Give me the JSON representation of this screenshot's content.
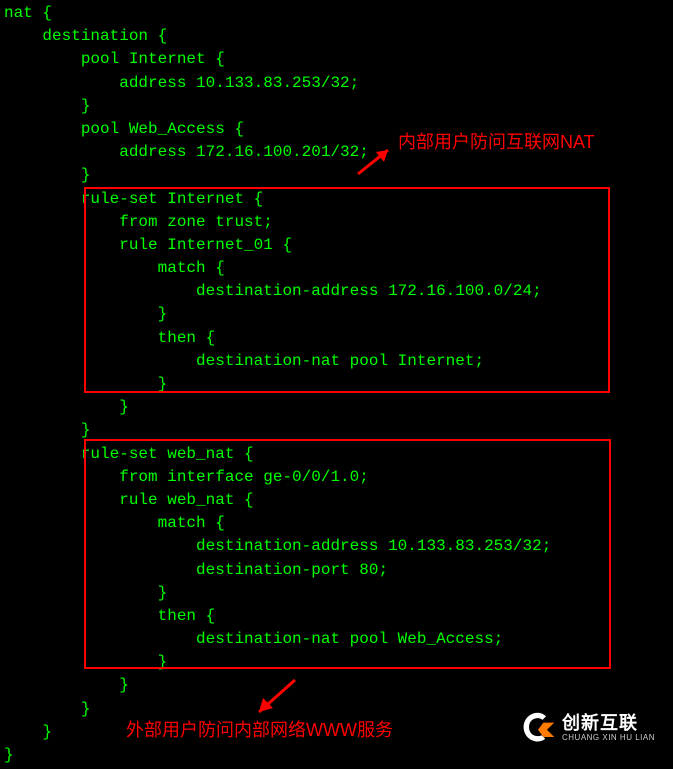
{
  "code": {
    "l1": "nat {",
    "l2": "    destination {",
    "l3": "        pool Internet {",
    "l4": "            address 10.133.83.253/32;",
    "l5": "        }",
    "l6": "        pool Web_Access {",
    "l7": "            address 172.16.100.201/32;",
    "l8": "        }",
    "l9": "        rule-set Internet {",
    "l10": "            from zone trust;",
    "l11": "            rule Internet_01 {",
    "l12": "                match {",
    "l13": "                    destination-address 172.16.100.0/24;",
    "l14": "                }",
    "l15": "                then {",
    "l16": "                    destination-nat pool Internet;",
    "l17": "                }",
    "l18": "            }",
    "l19": "        }",
    "l20": "        rule-set web_nat {",
    "l21": "            from interface ge-0/0/1.0;",
    "l22": "            rule web_nat {",
    "l23": "                match {",
    "l24": "                    destination-address 10.133.83.253/32;",
    "l25": "                    destination-port 80;",
    "l26": "                }",
    "l27": "                then {",
    "l28": "                    destination-nat pool Web_Access;",
    "l29": "                }",
    "l30": "            }",
    "l31": "        }",
    "l32": "    }",
    "l33": "}"
  },
  "annotations": {
    "top": "内部用户防问互联网NAT",
    "bottom": "外部用户防问内部网络WWW服务"
  },
  "logo": {
    "title": "创新互联",
    "subtitle": "CHUANG XIN HU LIAN"
  }
}
